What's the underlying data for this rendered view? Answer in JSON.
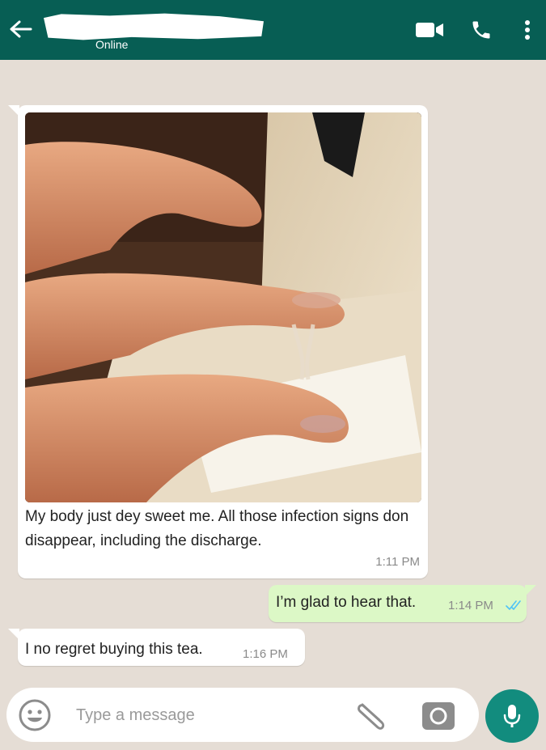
{
  "header": {
    "status": "Online",
    "icons": [
      "back-arrow-icon",
      "video-call-icon",
      "phone-call-icon",
      "more-options-icon"
    ],
    "color": "#075e54"
  },
  "messages": [
    {
      "direction": "incoming",
      "has_photo": true,
      "text": "My body just dey sweet me. All those infection signs don disappear, including the discharge.",
      "time": "1:11 PM"
    },
    {
      "direction": "outgoing",
      "text": "I’m glad to hear that.",
      "time": "1:14 PM",
      "read": true
    },
    {
      "direction": "incoming",
      "text": "I no regret buying this tea.",
      "time": "1:16 PM"
    }
  ],
  "composer": {
    "placeholder": "Type a message",
    "value": "",
    "icons": [
      "emoji-icon",
      "attach-icon",
      "camera-icon",
      "mic-icon"
    ]
  },
  "colors": {
    "chat_bg": "#e5ddd5",
    "outgoing_bubble": "#dcf8c6",
    "incoming_bubble": "#ffffff",
    "mic_button": "#128c7e",
    "read_ticks": "#4fc3f7"
  }
}
